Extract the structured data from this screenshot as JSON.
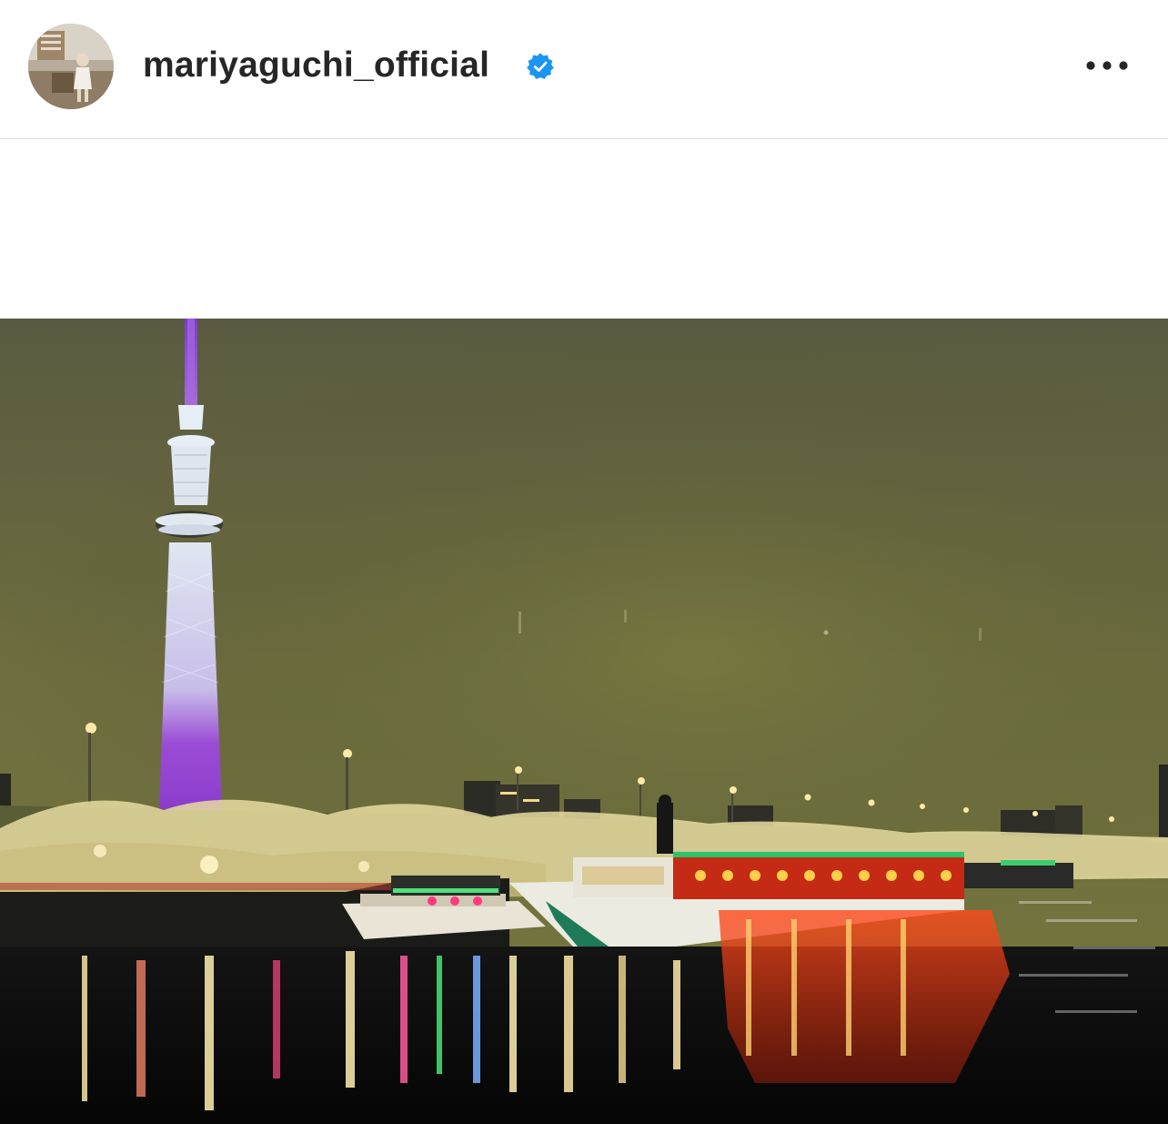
{
  "post_header": {
    "username": "mariyaguchi_official",
    "verified_icon": "verified-badge-icon",
    "more_icon": "more-horizontal-icon",
    "avatar_icon": "profile-avatar"
  },
  "post_media": {
    "image_icon": "night-river-photo"
  },
  "colors": {
    "verified_blue": "#1a95f0",
    "text_primary": "#262626",
    "divider": "#dbdbdb"
  }
}
